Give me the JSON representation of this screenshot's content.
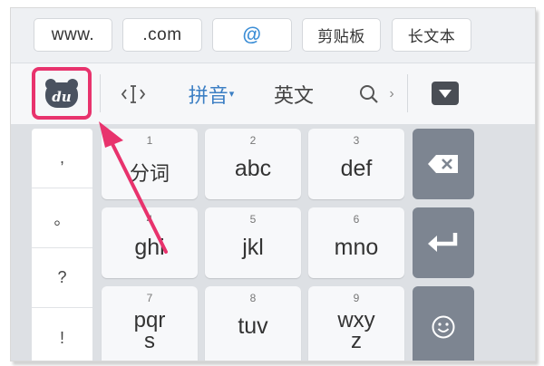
{
  "shortcuts": [
    {
      "label": "www.",
      "kind": "latin"
    },
    {
      "label": ".com",
      "kind": "latin"
    },
    {
      "label": "@",
      "kind": "at"
    },
    {
      "label": "剪贴板",
      "kind": "cn"
    },
    {
      "label": "长文本",
      "kind": "cn"
    }
  ],
  "toolbar": {
    "logo_text": "du",
    "cursor_icon_text": "‹I›",
    "pinyin_label": "拼音",
    "pinyin_caret": "▾",
    "english_label": "英文",
    "more_caret": "›"
  },
  "symbols": [
    ",",
    "。",
    "?",
    "!"
  ],
  "keys": [
    {
      "num": "1",
      "label": "分词"
    },
    {
      "num": "2",
      "label": "abc"
    },
    {
      "num": "3",
      "label": "def"
    },
    {
      "num": "4",
      "label": "ghi"
    },
    {
      "num": "5",
      "label": "jkl"
    },
    {
      "num": "6",
      "label": "mno"
    },
    {
      "num": "7",
      "label_line1": "pqr",
      "label_line2": "s"
    },
    {
      "num": "8",
      "label": "tuv"
    },
    {
      "num": "9",
      "label_line1": "wxy",
      "label_line2": "z"
    }
  ],
  "function_keys": [
    "delete-icon",
    "enter-icon",
    "emoji-icon"
  ],
  "colors": {
    "highlight": "#e8336d",
    "pinyin_accent": "#3c7fc4",
    "at_accent": "#3c8ed6",
    "function_key": "#7d8591",
    "logo_bg": "#4a5260"
  }
}
